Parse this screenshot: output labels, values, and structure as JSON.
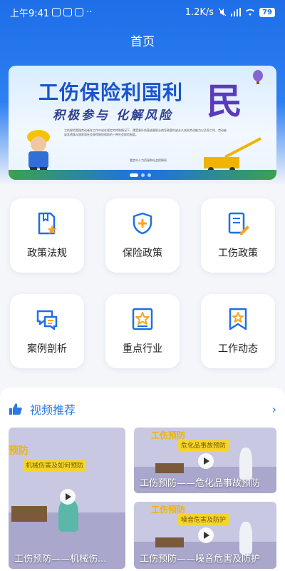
{
  "status": {
    "time": "上午9:41",
    "net_speed": "1.2K/s",
    "battery": "79"
  },
  "nav": {
    "title": "首页"
  },
  "banner": {
    "title": "工伤保险利国利",
    "title_big": "民",
    "subtitle": "积极参与 化解风险",
    "body": "工伤保险是指劳动者在工作中或在规定的特殊情况下，遭受意外伤害或患职业病导致暂时或永久丧失劳动能力以及死亡时，劳动者或其遗属从国家和社会获得物质帮助的一种社会保险制度。",
    "footnote": "嘉定市人力资源和社会保障局"
  },
  "grid_items": [
    {
      "label": "政策法规",
      "icon": "book-star-icon"
    },
    {
      "label": "保险政策",
      "icon": "shield-plus-icon"
    },
    {
      "label": "工伤政策",
      "icon": "document-pen-icon"
    },
    {
      "label": "案例剖析",
      "icon": "chat-bubbles-icon"
    },
    {
      "label": "重点行业",
      "icon": "star-frame-icon"
    },
    {
      "label": "工作动态",
      "icon": "bookmark-star-icon"
    }
  ],
  "video_section": {
    "title": "视频推荐",
    "videos": [
      {
        "title": "工伤预防——机械伤...",
        "tag": "机械伤害及如何预防",
        "tag_big": "预防"
      },
      {
        "title": "工伤预防——危化品事故预防",
        "tag": "危化品事故预防",
        "tag_big": "工伤预防"
      },
      {
        "title": "工伤预防——噪音危害及防护",
        "tag": "噪音危害及防护",
        "tag_big": "工伤预防"
      }
    ]
  },
  "colors": {
    "primary": "#1e6fe8",
    "accent": "#f5a623"
  }
}
